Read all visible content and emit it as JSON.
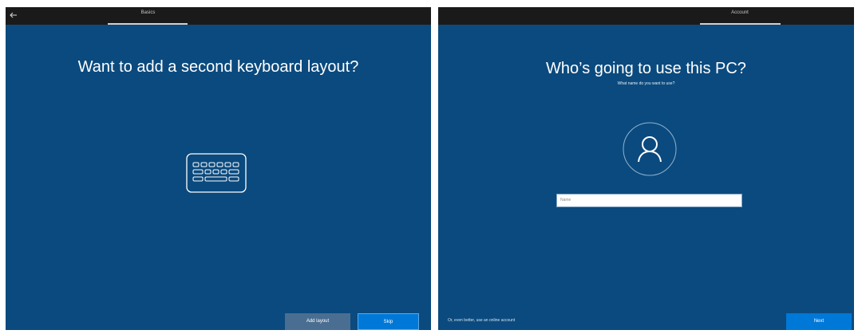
{
  "left_screen": {
    "tab_label": "Basics",
    "headline": "Want to add a second keyboard layout?",
    "keyboard_icon": "keyboard-icon",
    "back_icon": "back-arrow-icon",
    "buttons": {
      "add_layout": "Add layout",
      "skip": "Skip"
    }
  },
  "right_screen": {
    "tab_label": "Account",
    "headline": "Who’s going to use this PC?",
    "subheadline": "What name do you want to use?",
    "avatar_icon": "user-icon",
    "name_input": {
      "placeholder": "Name",
      "value": ""
    },
    "online_link": "Or, even better, use an online account",
    "buttons": {
      "next": "Next"
    }
  },
  "colors": {
    "panel_bg": "#0b4a7e",
    "topbar_bg": "#1a1a1a",
    "primary_button": "#0078d7",
    "secondary_button": "#4a6e91"
  }
}
